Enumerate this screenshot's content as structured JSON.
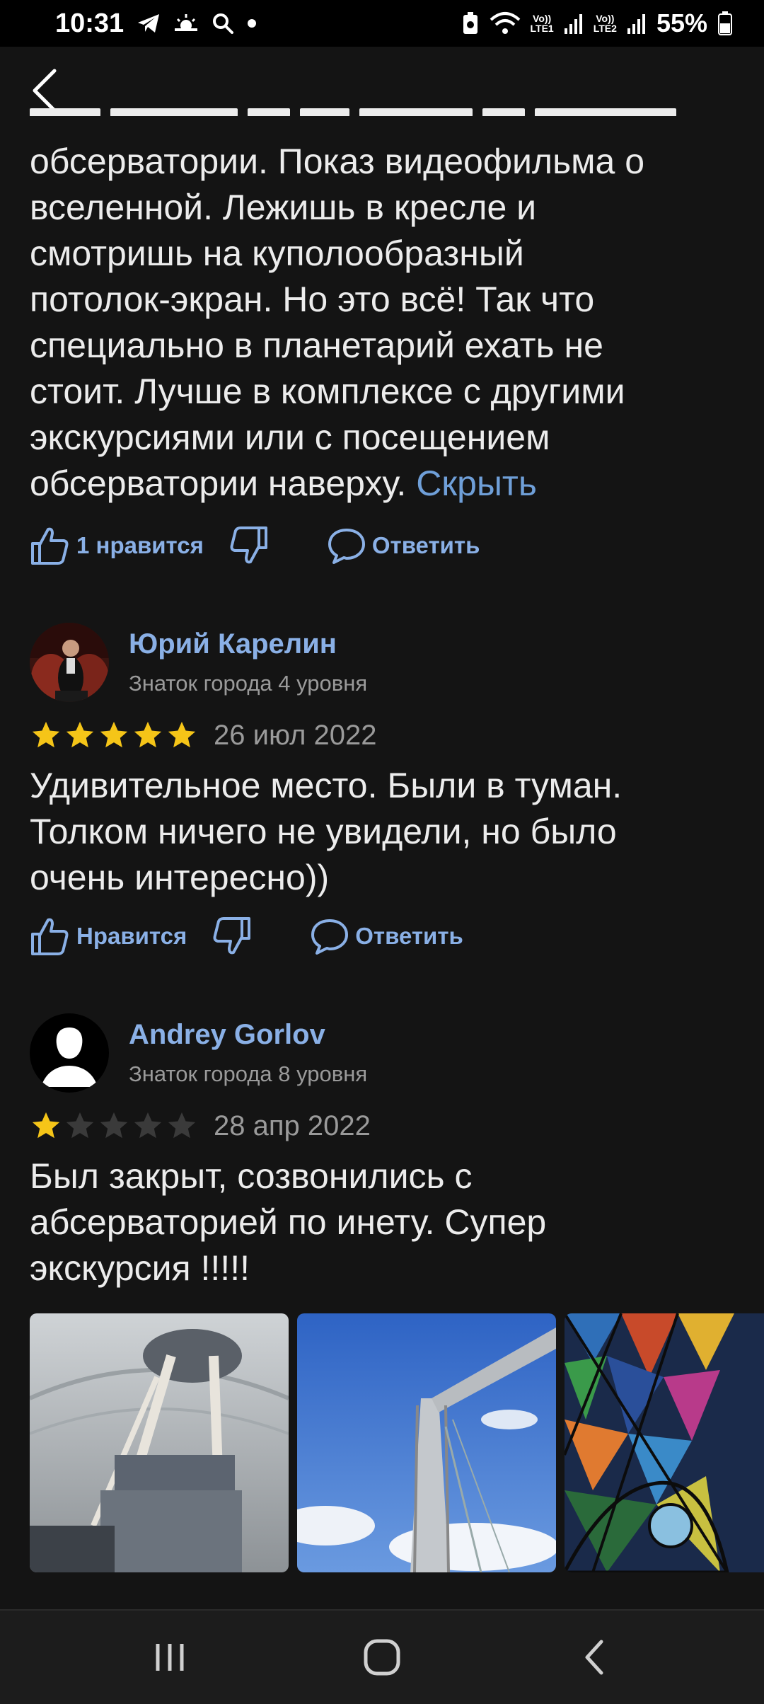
{
  "status_bar": {
    "time": "10:31",
    "battery": "55%",
    "sim1": "LTE1",
    "sim2": "LTE2",
    "volte": "Vo))"
  },
  "first_review": {
    "text_lines": [
      "обсерватории. Показ видеофильма о",
      "вселенной. Лежишь в кресле и",
      "смотришь на куполообразный",
      "потолок-экран. Но это всё! Так что",
      "специально в планетарий ехать не",
      "стоит. Лучше в комплексе с другими",
      "экскурсиями или с посещением"
    ],
    "last_line": "обсерватории наверху.",
    "hide_label": "Скрыть",
    "like_label": "1 нравится",
    "reply_label": "Ответить"
  },
  "reviews": [
    {
      "author": "Юрий Карелин",
      "level": "Знаток города 4 уровня",
      "rating": 5,
      "date": "26 июл 2022",
      "text_lines": [
        "Удивительное место. Были в туман.",
        "Толком ничего не увидели, но было",
        "очень интересно))"
      ],
      "like_label": "Нравится",
      "reply_label": "Ответить"
    },
    {
      "author": "Andrey Gorlov",
      "level": "Знаток города 8 уровня",
      "rating": 1,
      "date": "28 апр 2022",
      "text_lines": [
        "Был закрыт, созвонились с",
        "абсерваторией по инету. Супер",
        "экскурсия !!!!!"
      ],
      "photos": [
        "telescope-photo",
        "tower-photo",
        "stained-glass-photo"
      ]
    }
  ],
  "colors": {
    "background": "#141414",
    "link": "#8ab0e6",
    "star_filled": "#f5c518",
    "star_empty": "#3a3a3a",
    "muted": "#9a9a9a"
  }
}
